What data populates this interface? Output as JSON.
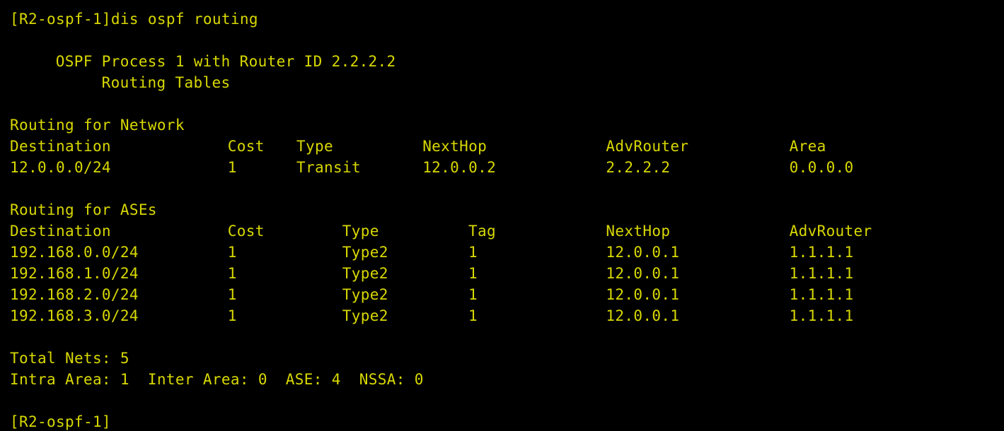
{
  "terminal": {
    "background_color": "#000000",
    "text_color": "#d8d800",
    "char_width": 16.2,
    "line_height": 30
  },
  "command_line": {
    "prompt": "[R2-ospf-1]",
    "command": "dis ospf routing",
    "full": "[R2-ospf-1]dis ospf routing"
  },
  "header": {
    "process_line": "OSPF Process 1 with Router ID 2.2.2.2",
    "tables_line": "Routing Tables",
    "process_indent": 4,
    "tables_indent": 8
  },
  "network_section": {
    "heading": "Routing for Network",
    "columns": [
      {
        "label": "Destination",
        "col": 0
      },
      {
        "label": "Cost",
        "col": 19
      },
      {
        "label": "Type",
        "col": 25
      },
      {
        "label": "NextHop",
        "col": 36
      },
      {
        "label": "AdvRouter",
        "col": 52
      },
      {
        "label": "Area",
        "col": 68
      }
    ],
    "rows": [
      {
        "Destination": "12.0.0.0/24",
        "Cost": "1",
        "Type": "Transit",
        "NextHop": "12.0.0.2",
        "AdvRouter": "2.2.2.2",
        "Area": "0.0.0.0"
      }
    ]
  },
  "ase_section": {
    "heading": "Routing for ASEs",
    "columns": [
      {
        "label": "Destination",
        "col": 0
      },
      {
        "label": "Cost",
        "col": 19
      },
      {
        "label": "Type",
        "col": 29
      },
      {
        "label": "Tag",
        "col": 40
      },
      {
        "label": "NextHop",
        "col": 52
      },
      {
        "label": "AdvRouter",
        "col": 68
      }
    ],
    "rows": [
      {
        "Destination": "192.168.0.0/24",
        "Cost": "1",
        "Type": "Type2",
        "Tag": "1",
        "NextHop": "12.0.0.1",
        "AdvRouter": "1.1.1.1"
      },
      {
        "Destination": "192.168.1.0/24",
        "Cost": "1",
        "Type": "Type2",
        "Tag": "1",
        "NextHop": "12.0.0.1",
        "AdvRouter": "1.1.1.1"
      },
      {
        "Destination": "192.168.2.0/24",
        "Cost": "1",
        "Type": "Type2",
        "Tag": "1",
        "NextHop": "12.0.0.1",
        "AdvRouter": "1.1.1.1"
      },
      {
        "Destination": "192.168.3.0/24",
        "Cost": "1",
        "Type": "Type2",
        "Tag": "1",
        "NextHop": "12.0.0.1",
        "AdvRouter": "1.1.1.1"
      }
    ]
  },
  "summary": {
    "total_nets_line": "Total Nets: 5",
    "counts_line": "Intra Area: 1  Inter Area: 0  ASE: 4  NSSA: 0",
    "total_nets": 5,
    "intra_area": 1,
    "inter_area": 0,
    "ase": 4,
    "nssa": 0
  },
  "trailing_prompt": {
    "text": "[R2-ospf-1]"
  }
}
